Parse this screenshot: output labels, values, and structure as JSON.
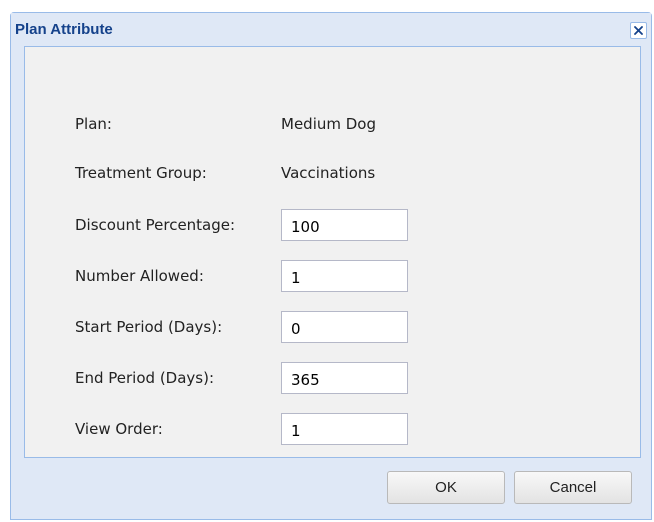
{
  "dialog": {
    "title": "Plan Attribute",
    "close_icon": "close-icon"
  },
  "info": {
    "plan_label": "Plan:",
    "plan_value": "Medium Dog",
    "treatment_group_label": "Treatment Group:",
    "treatment_group_value": "Vaccinations"
  },
  "fields": {
    "discount_label": "Discount Percentage:",
    "discount_value": "100",
    "number_allowed_label": "Number Allowed:",
    "number_allowed_value": "1",
    "start_period_label": "Start Period (Days):",
    "start_period_value": "0",
    "end_period_label": "End Period (Days):",
    "end_period_value": "365",
    "view_order_label": "View Order:",
    "view_order_value": "1"
  },
  "buttons": {
    "ok_label": "OK",
    "cancel_label": "Cancel"
  },
  "colors": {
    "title_text": "#15428b",
    "window_bg": "#dfe8f6",
    "border": "#99bbe8",
    "panel_bg": "#f1f1f1"
  }
}
